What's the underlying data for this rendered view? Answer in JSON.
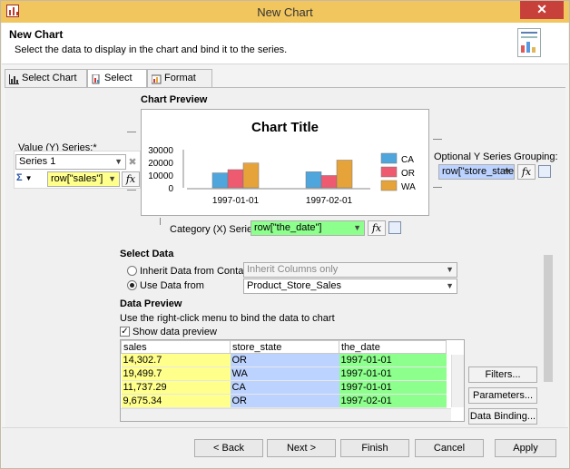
{
  "window": {
    "title": "New Chart",
    "close_symbol": "✕"
  },
  "header": {
    "title": "New Chart",
    "description": "Select the data to display in the chart and bind it to the series."
  },
  "tabs": [
    {
      "label": "Select Chart Type",
      "icon": "chart-type-icon"
    },
    {
      "label": "Select Data",
      "icon": "select-data-icon",
      "active": true
    },
    {
      "label": "Format Chart",
      "icon": "format-chart-icon"
    }
  ],
  "preview": {
    "section_label": "Chart Preview",
    "chart_title": "Chart Title"
  },
  "value_series": {
    "label": "Value (Y) Series:*",
    "series": "Series 1",
    "sigma": "Σ",
    "expression": "row[\"sales\"]",
    "fx": "fx"
  },
  "y_grouping": {
    "label": "Optional Y Series Grouping:",
    "expression": "row[\"store_state\"]",
    "fx": "fx"
  },
  "category_series": {
    "label": "Category (X) Series:*",
    "expression": "row[\"the_date\"]",
    "fx": "fx"
  },
  "select_data": {
    "section_label": "Select Data",
    "option_inherit": "Inherit Data from Container",
    "inherit_value": "Inherit Columns only",
    "option_use": "Use Data from",
    "use_value": "Product_Store_Sales"
  },
  "data_preview": {
    "section_label": "Data Preview",
    "hint": "Use the right-click menu to bind the data to chart",
    "show_label": "Show data preview",
    "columns": [
      "sales",
      "store_state",
      "the_date"
    ],
    "rows": [
      [
        "14,302.7",
        "OR",
        "1997-01-01"
      ],
      [
        "19,499.7",
        "WA",
        "1997-01-01"
      ],
      [
        "11,737.29",
        "CA",
        "1997-01-01"
      ],
      [
        "9,675.34",
        "OR",
        "1997-02-01"
      ]
    ]
  },
  "side_buttons": {
    "filters": "Filters...",
    "parameters": "Parameters...",
    "data_binding": "Data Binding..."
  },
  "footer": {
    "back": "< Back",
    "next": "Next >",
    "finish": "Finish",
    "cancel": "Cancel",
    "apply": "Apply"
  },
  "colors": {
    "CA": "#4ea6dc",
    "OR": "#ee5a70",
    "WA": "#e5a33a",
    "titlebar": "#f1c65e"
  },
  "chart_data": {
    "type": "bar",
    "title": "Chart Title",
    "categories": [
      "1997-01-01",
      "1997-02-01"
    ],
    "series": [
      {
        "name": "CA",
        "values": [
          11737.29,
          12600
        ]
      },
      {
        "name": "OR",
        "values": [
          14302.7,
          9675.34
        ]
      },
      {
        "name": "WA",
        "values": [
          19499.7,
          21800
        ]
      }
    ],
    "y_ticks": [
      "30000",
      "20000",
      "10000",
      "0"
    ],
    "ylim": [
      0,
      30000
    ],
    "legend_placement": "right"
  }
}
